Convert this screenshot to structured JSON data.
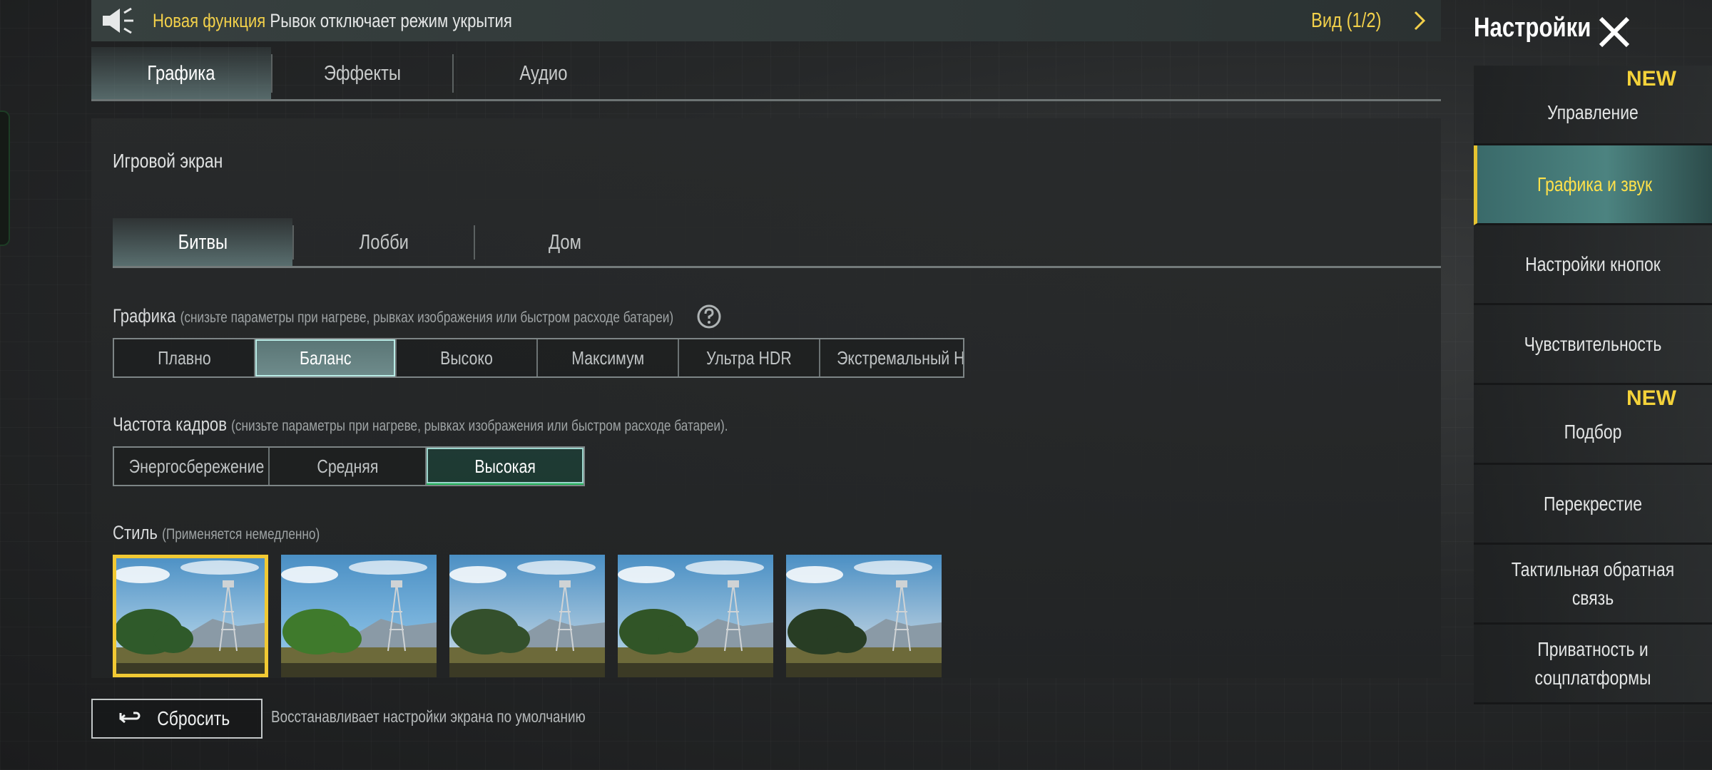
{
  "banner": {
    "highlight": "Новая функция",
    "text": "Рывок отключает режим укрытия",
    "view": "Вид (1/2)",
    "icons": [
      "speaker-icon",
      "chevron-right-icon"
    ]
  },
  "top_tabs": [
    "Графика",
    "Эффекты",
    "Аудио"
  ],
  "section_title": "Игровой экран",
  "sub_tabs": [
    "Битвы",
    "Лобби",
    "Дом"
  ],
  "graphics": {
    "label": "Графика",
    "hint": "(снизьте параметры при нагреве, рывках изображения или быстром расходе батареи)",
    "options": [
      "Плавно",
      "Баланс",
      "Высоко",
      "Максимум",
      "Ультра HDR",
      "Экстремальный HDR"
    ],
    "selected": "Баланс"
  },
  "fps": {
    "label": "Частота кадров",
    "hint": "(снизьте параметры при нагреве, рывках изображения или быстром расходе батареи).",
    "options": [
      "Энергосбережение",
      "Средняя",
      "Высокая"
    ],
    "selected": "Высокая"
  },
  "style": {
    "label": "Стиль",
    "hint": "(Применяется немедленно)",
    "thumbnails": 5,
    "selected_index": 0
  },
  "reset": {
    "label": "Сбросить",
    "description": "Восстанавливает настройки экрана по умолчанию"
  },
  "sidebar": {
    "title": "Настройки",
    "items": [
      {
        "label": "Управление",
        "badge": "NEW"
      },
      {
        "label": "Графика и звук",
        "active": true
      },
      {
        "label": "Настройки кнопок"
      },
      {
        "label": "Чувствительность"
      },
      {
        "label": "Подбор",
        "badge": "NEW"
      },
      {
        "label": "Перекрестие"
      },
      {
        "label": "Тактильная обратная связь"
      },
      {
        "label": "Приватность и соцплатформы"
      }
    ]
  },
  "colors": {
    "accent_yellow": "#f2d04a",
    "accent_teal": "#a9d9d5",
    "fps_green": "#23b35a"
  }
}
